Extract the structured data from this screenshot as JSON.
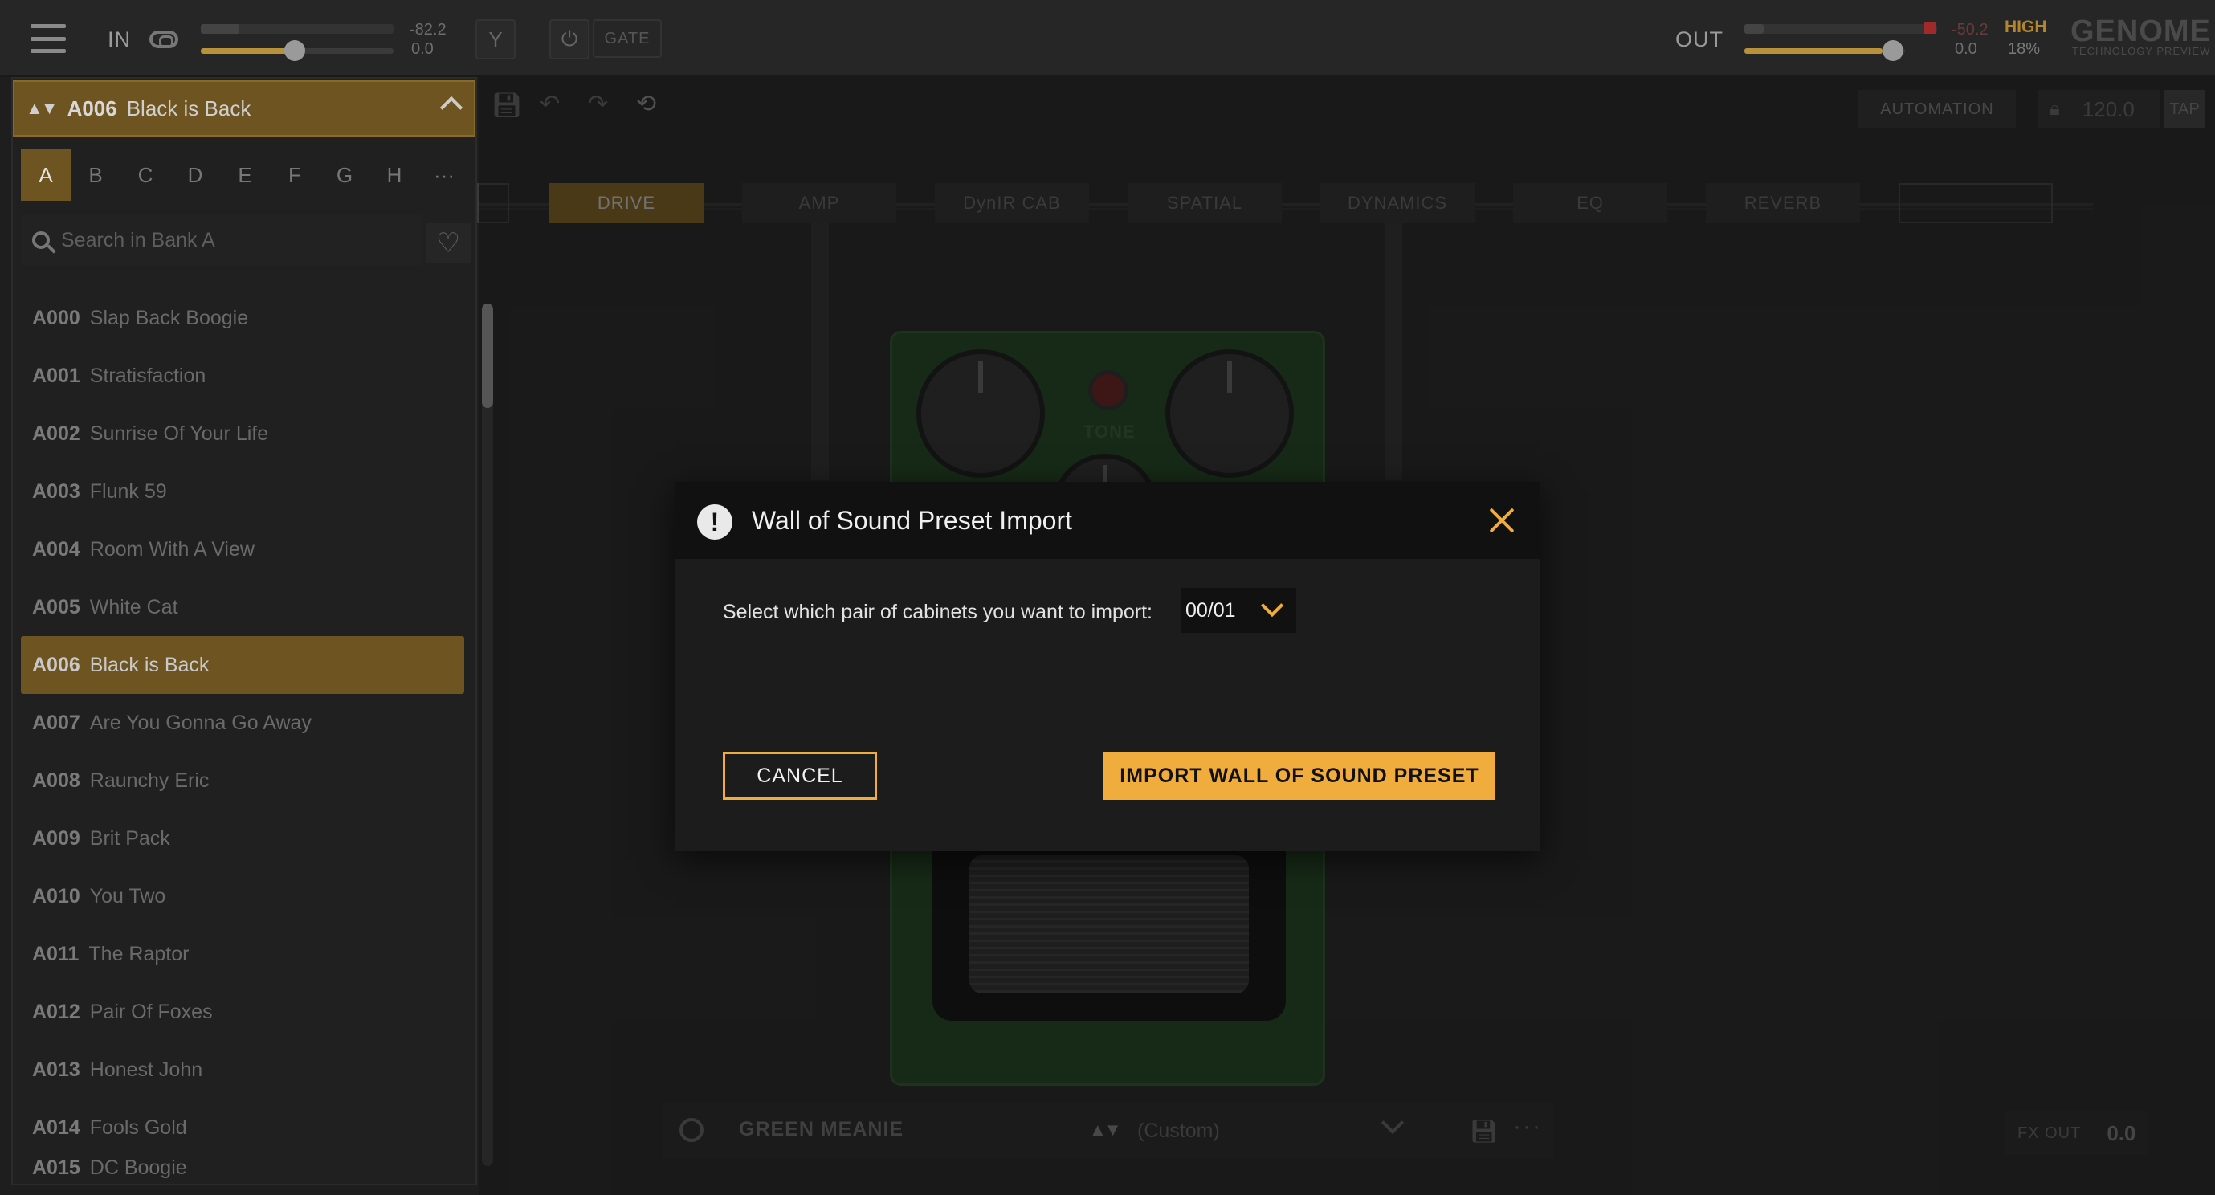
{
  "topbar": {
    "in_label": "IN",
    "in_meter_value": "-82.2",
    "in_gain_value": "0.0",
    "gate_label": "GATE",
    "out_label": "OUT",
    "out_meter_value": "-50.2",
    "out_gain_value": "0.0",
    "quality_label": "HIGH",
    "cpu_value": "18%",
    "brand": "GENOME",
    "brand_sub": "TECHNOLOGY PREVIEW"
  },
  "preset_panel": {
    "current_code": "A006",
    "current_name": "Black is Back",
    "banks": [
      "A",
      "B",
      "C",
      "D",
      "E",
      "F",
      "G",
      "H"
    ],
    "more_label": "···",
    "search_placeholder": "Search in Bank A",
    "presets": [
      {
        "code": "A000",
        "name": "Slap Back Boogie"
      },
      {
        "code": "A001",
        "name": "Stratisfaction"
      },
      {
        "code": "A002",
        "name": "Sunrise Of Your Life"
      },
      {
        "code": "A003",
        "name": "Flunk 59"
      },
      {
        "code": "A004",
        "name": "Room With A View"
      },
      {
        "code": "A005",
        "name": "White Cat"
      },
      {
        "code": "A006",
        "name": "Black is Back"
      },
      {
        "code": "A007",
        "name": "Are You Gonna Go Away"
      },
      {
        "code": "A008",
        "name": "Raunchy Eric"
      },
      {
        "code": "A009",
        "name": "Brit Pack"
      },
      {
        "code": "A010",
        "name": "You Two"
      },
      {
        "code": "A011",
        "name": "The Raptor"
      },
      {
        "code": "A012",
        "name": "Pair Of Foxes"
      },
      {
        "code": "A013",
        "name": "Honest John"
      },
      {
        "code": "A014",
        "name": "Fools Gold"
      },
      {
        "code": "A015",
        "name": "DC Boogie"
      }
    ]
  },
  "editor": {
    "automation_label": "AUTOMATION",
    "bpm": "120.0",
    "tap_label": "TAP",
    "chain": [
      "DRIVE",
      "AMP",
      "DynIR CAB",
      "SPATIAL",
      "DYNAMICS",
      "EQ",
      "REVERB"
    ],
    "pedal_label": "TONE",
    "module_name": "GREEN MEANIE",
    "module_preset": "(Custom)",
    "fx_out_label": "FX OUT",
    "fx_out_value": "0.0"
  },
  "modal": {
    "title": "Wall of Sound Preset Import",
    "prompt": "Select which pair of cabinets you want to import:",
    "cabinet_selection": "00/01",
    "cancel_label": "CANCEL",
    "import_label": "IMPORT WALL OF SOUND PRESET"
  },
  "colors": {
    "accent": "#f0ad3d",
    "selected_bg": "#6e5420"
  }
}
